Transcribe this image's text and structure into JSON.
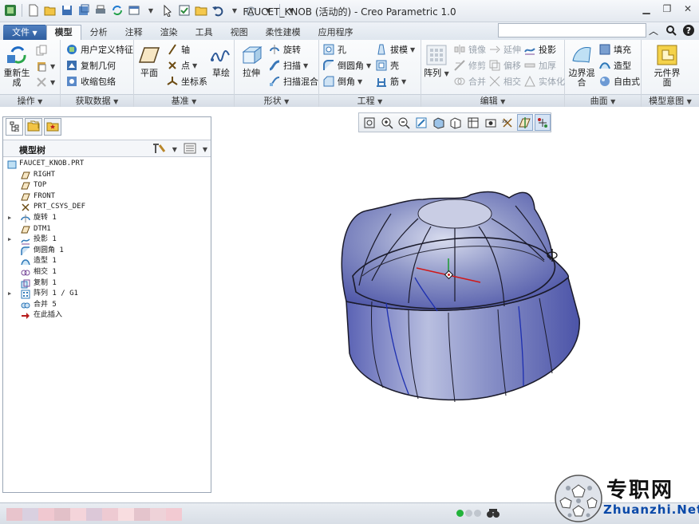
{
  "window": {
    "title": "FAUCET_KNOB (活动的) - Creo Parametric 1.0"
  },
  "tabs": [
    "文件",
    "模型",
    "分析",
    "注释",
    "渲染",
    "工具",
    "视图",
    "柔性建模",
    "应用程序"
  ],
  "ribbon": {
    "groups": {
      "operations": "操作",
      "get_data": "获取数据",
      "datum": "基准",
      "shapes": "形状",
      "engineering": "工程",
      "editing": "编辑",
      "surfaces": "曲面",
      "model_intent": "模型意图"
    },
    "regenerate": "重新生成",
    "udf": "用户定义特征",
    "copy_geom": "复制几何",
    "shrinkwrap": "收缩包络",
    "plane": "平面",
    "axis": "轴",
    "point": "点",
    "csys": "坐标系",
    "sketch": "草绘",
    "extrude": "拉伸",
    "revolve": "旋转",
    "sweep": "扫描",
    "swept_blend": "扫描混合",
    "hole": "孔",
    "round": "倒圆角",
    "chamfer": "倒角",
    "draft": "拔模",
    "shell": "壳",
    "rib": "筋",
    "pattern": "阵列",
    "mirror": "镜像",
    "trim": "修剪",
    "merge": "合并",
    "extend": "延伸",
    "offset": "偏移",
    "intersect": "相交",
    "project": "投影",
    "thicken": "加厚",
    "solidify": "实体化",
    "boundary_blend": "边界混合",
    "fill": "填充",
    "style": "造型",
    "freestyle": "自由式",
    "component_interface": "元件界面"
  },
  "model_tree": {
    "title": "模型树",
    "items": [
      {
        "label": "FAUCET_KNOB.PRT",
        "icon": "part-icon",
        "expandable": false
      },
      {
        "label": "RIGHT",
        "icon": "datum-plane-icon",
        "expandable": false
      },
      {
        "label": "TOP",
        "icon": "datum-plane-icon",
        "expandable": false
      },
      {
        "label": "FRONT",
        "icon": "datum-plane-icon",
        "expandable": false
      },
      {
        "label": "PRT_CSYS_DEF",
        "icon": "csys-icon",
        "expandable": false
      },
      {
        "label": "旋转 1",
        "icon": "revolve-icon",
        "expandable": true
      },
      {
        "label": "DTM1",
        "icon": "datum-plane-icon",
        "expandable": false
      },
      {
        "label": "投影 1",
        "icon": "project-icon",
        "expandable": true
      },
      {
        "label": "倒圆角 1",
        "icon": "round-icon",
        "expandable": false
      },
      {
        "label": "造型 1",
        "icon": "style-icon",
        "expandable": false
      },
      {
        "label": "相交 1",
        "icon": "intersect-icon",
        "expandable": false
      },
      {
        "label": "复制 1",
        "icon": "copy-icon",
        "expandable": false
      },
      {
        "label": "阵列 1 / G1",
        "icon": "pattern-icon",
        "expandable": true
      },
      {
        "label": "合并 5",
        "icon": "merge-icon",
        "expandable": false
      },
      {
        "label": "在此插入",
        "icon": "insert-here-icon",
        "expandable": false
      }
    ]
  },
  "watermark": {
    "cn": "专职网",
    "en": "Zhuanzhi.Net"
  }
}
